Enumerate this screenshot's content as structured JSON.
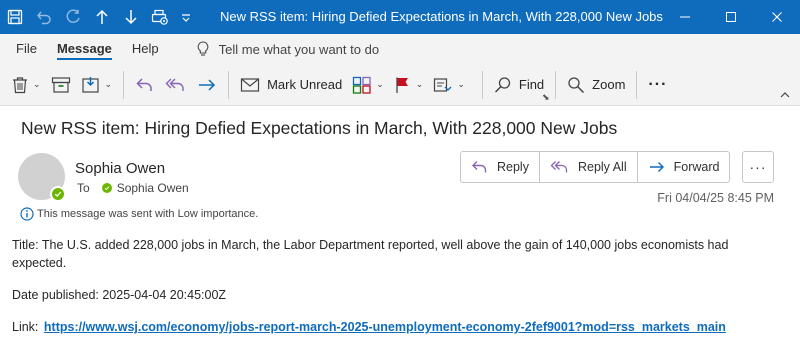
{
  "window": {
    "title": "New RSS item: Hiring Defied Expectations in March, With 228,000 New Jobs"
  },
  "menu": {
    "tabs": [
      "File",
      "Message",
      "Help"
    ],
    "active": "Message",
    "tell_me": "Tell me what you want to do"
  },
  "ribbon": {
    "mark_unread": "Mark Unread",
    "find": "Find",
    "zoom": "Zoom",
    "more": "···"
  },
  "message": {
    "subject": "New RSS item: Hiring Defied Expectations in March, With 228,000 New Jobs",
    "sender": "Sophia Owen",
    "to_label": "To",
    "recipient": "Sophia Owen",
    "importance_note": "This message was sent with Low importance.",
    "datetime": "Fri 04/04/25 8:45 PM",
    "actions": {
      "reply": "Reply",
      "reply_all": "Reply All",
      "forward": "Forward",
      "more": "···"
    },
    "body": {
      "title_line": "Title: The U.S. added 228,000 jobs in March, the Labor Department reported, well above the gain of 140,000 jobs economists had expected.",
      "date_line": "Date published: 2025-04-04 20:45:00Z",
      "link_label": "Link:",
      "link_url": "https://www.wsj.com/economy/jobs-report-march-2025-unemployment-economy-2fef9001?mod=rss_markets_main"
    }
  },
  "colors": {
    "titlebar": "#0f6cbd",
    "presence": "#6bb700",
    "accent": "#0f6cbd",
    "reply_icon": "#8764b8",
    "forward_icon": "#0f6cbd"
  },
  "icons": {
    "quick_access": [
      "save-icon",
      "undo-icon",
      "redo-icon",
      "up-arrow-icon",
      "down-arrow-icon",
      "print-icon",
      "customize-caret-icon"
    ],
    "window": [
      "minimize-icon",
      "restore-icon",
      "close-icon"
    ]
  }
}
